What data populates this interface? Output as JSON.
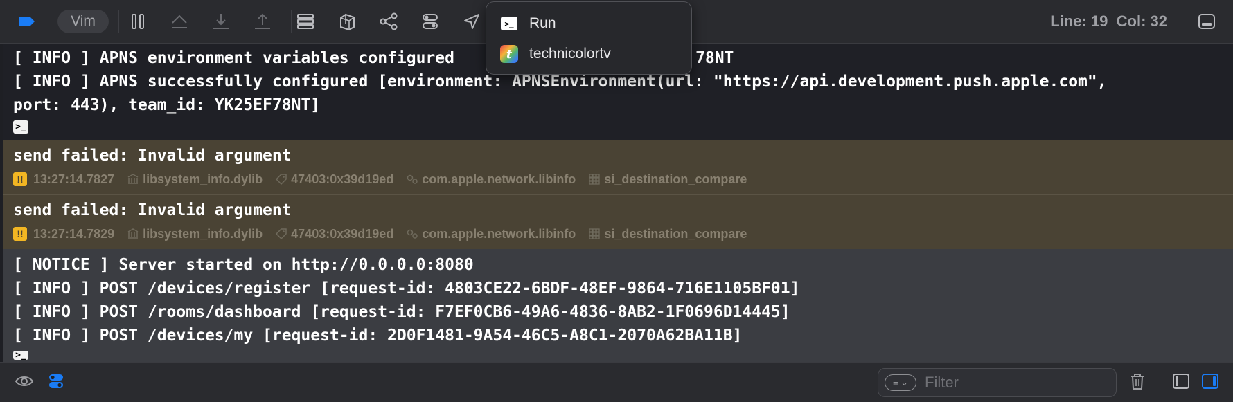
{
  "toolbar": {
    "vim_label": "Vim",
    "line_col": "Line: 19  Col: 32",
    "icons": [
      "breakpoint-icon",
      "pause-icon",
      "step-over-icon",
      "step-into-icon",
      "step-out-icon",
      "view-hierarchy-icon",
      "memory-graph-icon",
      "environment-overrides-icon",
      "simulate-location-icon"
    ]
  },
  "menu": {
    "items": [
      {
        "label": "Run",
        "icon": "terminal-icon"
      },
      {
        "label": "technicolortv",
        "icon": "app-icon"
      }
    ]
  },
  "console": {
    "block1": {
      "lines": [
        "[ INFO ] APNS environment variables configured",
        "[ INFO ] APNS successfully configured [environment: APNSEnvironment(url: \"https://api.development.push.apple.com\",",
        "port: 443), team_id: YK25EF78NT]"
      ],
      "line1_tail": "78NT",
      "prompt": ">_"
    },
    "warnings": [
      {
        "message": "send failed: Invalid argument",
        "badge": "!!",
        "time": "13:27:14.7827",
        "library": "libsystem_info.dylib",
        "pid_tid": "47403:0x39d19ed",
        "subsystem": "com.apple.network.libinfo",
        "category": "si_destination_compare"
      },
      {
        "message": "send failed: Invalid argument",
        "badge": "!!",
        "time": "13:27:14.7829",
        "library": "libsystem_info.dylib",
        "pid_tid": "47403:0x39d19ed",
        "subsystem": "com.apple.network.libinfo",
        "category": "si_destination_compare"
      }
    ],
    "block4": {
      "lines": [
        "[ NOTICE ] Server started on http://0.0.0.0:8080",
        "[ INFO ] POST /devices/register [request-id: 4803CE22-6BDF-48EF-9864-716E1105BF01]",
        "[ INFO ] POST /rooms/dashboard [request-id: F7EF0CB6-49A6-4836-8AB2-1F0696D14445]",
        "[ INFO ] POST /devices/my [request-id: 2D0F1481-9A54-46C5-A8C1-2070A62BA11B]"
      ],
      "prompt": ">_"
    }
  },
  "bottombar": {
    "filter_placeholder": "Filter"
  },
  "colors": {
    "accent": "#1a7cf5",
    "warning": "#f2b623",
    "warning_row_bg": "#4a4334"
  }
}
